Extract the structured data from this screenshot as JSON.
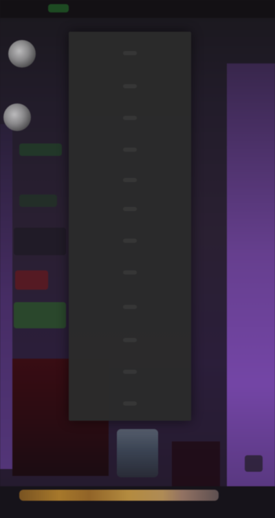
{
  "colors": {
    "background": "#1f1b24",
    "menu_bg": "#2b2b2b",
    "accent_purple": "#7c4ab2",
    "accent_green": "#215e27",
    "accent_red": "#3a0b0f",
    "accent_orange": "#c08a2e"
  },
  "context_menu": {
    "items": [
      {
        "label": "",
        "icon": ""
      },
      {
        "label": "",
        "icon": ""
      },
      {
        "label": "",
        "icon": ""
      },
      {
        "label": "",
        "icon": ""
      },
      {
        "label": "",
        "icon": ""
      },
      {
        "label": "",
        "icon": ""
      },
      {
        "label": "",
        "icon": ""
      },
      {
        "label": "",
        "icon": ""
      },
      {
        "label": "",
        "icon": ""
      },
      {
        "label": "",
        "icon": ""
      },
      {
        "label": "",
        "icon": ""
      },
      {
        "label": "",
        "icon": ""
      }
    ]
  }
}
